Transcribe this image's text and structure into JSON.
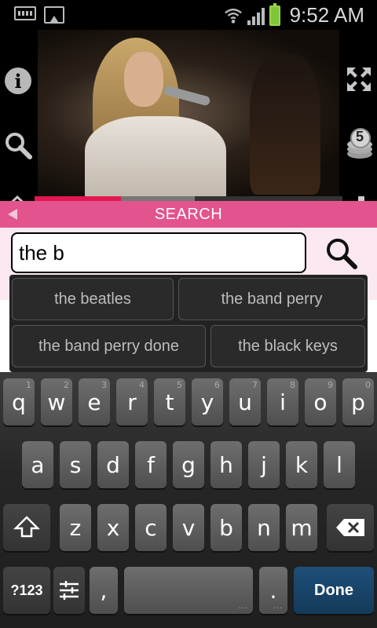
{
  "status_bar": {
    "time": "9:52 AM"
  },
  "video": {
    "progress": 0.28,
    "buffered": 0.52
  },
  "side_controls": {
    "info_glyph": "i",
    "coins_count": "5"
  },
  "search_header": {
    "title": "SEARCH"
  },
  "search": {
    "query": "the b"
  },
  "suggestions": [
    "the beatles",
    "the band perry",
    "the band perry done",
    "the black keys"
  ],
  "keyboard": {
    "row1": [
      "q",
      "w",
      "e",
      "r",
      "t",
      "y",
      "u",
      "i",
      "o",
      "p"
    ],
    "row1_hints": [
      "1",
      "2",
      "3",
      "4",
      "5",
      "6",
      "7",
      "8",
      "9",
      "0"
    ],
    "row2": [
      "a",
      "s",
      "d",
      "f",
      "g",
      "h",
      "j",
      "k",
      "l"
    ],
    "row3": [
      "z",
      "x",
      "c",
      "v",
      "b",
      "n",
      "m"
    ],
    "symbols_label": "?123",
    "comma_label": ",",
    "period_label": ".",
    "done_label": "Done"
  },
  "colors": {
    "accent_pink": "#e3538d",
    "progress_red": "#e3174f",
    "done_blue": "#1d4f78"
  },
  "icons": [
    "keyboard-icon",
    "image-icon",
    "wifi-icon",
    "signal-icon",
    "battery-icon",
    "info-icon",
    "search-icon",
    "home-icon",
    "fullscreen-icon",
    "coins-icon",
    "menu-icon",
    "back-arrow-icon",
    "shift-icon",
    "backspace-icon",
    "settings-sliders-icon"
  ]
}
